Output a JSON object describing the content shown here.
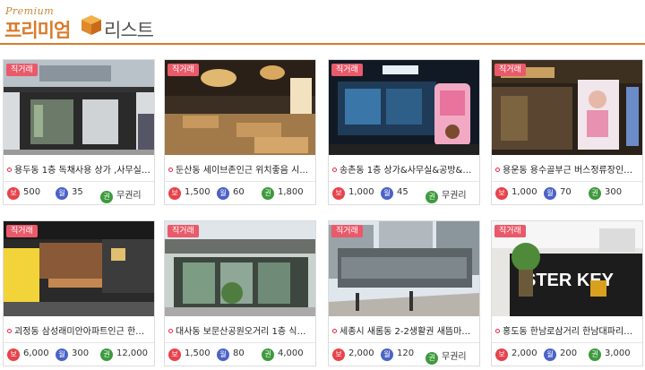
{
  "header": {
    "logo_premium": "Premium",
    "logo_text_1": "프리미엄",
    "logo_text_2": "리스트"
  },
  "labels": {
    "bo": "보",
    "wol": "월",
    "gwon": "권"
  },
  "colors": {
    "accent": "#d97b2a",
    "badge": "#e95a6a",
    "bo": "#e8424b",
    "wol": "#4b63c8",
    "gwon": "#3d9a3d"
  },
  "listings": [
    {
      "badge": "직거래",
      "title": "용두동 1층 독채사용 상가 ,사무실 ...",
      "deposit": "500",
      "monthly": "35",
      "premium": "무권리"
    },
    {
      "badge": "직거래",
      "title": "둔산동 세이브존인근 위치좋음 시...",
      "deposit": "1,500",
      "monthly": "60",
      "premium": "1,800"
    },
    {
      "badge": "직거래",
      "title": "송촌동 1층 상가&사무실&공방&작...",
      "deposit": "1,000",
      "monthly": "45",
      "premium": "무권리"
    },
    {
      "badge": "직거래",
      "title": "용운동 용수골부근 버스정류장인근...",
      "deposit": "1,000",
      "monthly": "70",
      "premium": "300"
    },
    {
      "badge": "직거래",
      "title": "괴정동 삼성래미안아파트인근 한민...",
      "deposit": "6,000",
      "monthly": "300",
      "premium": "12,000"
    },
    {
      "badge": "직거래",
      "title": "대사동 보문산공원오거리 1층 식당...",
      "deposit": "1,500",
      "monthly": "80",
      "premium": "4,000"
    },
    {
      "badge": "직거래",
      "title": "세종시 새롬동 2-2생활권 새뜸마을...",
      "deposit": "2,000",
      "monthly": "120",
      "premium": "무권리"
    },
    {
      "badge": "직거래",
      "title": "홍도동 한남로삼거리 한남대파리바...",
      "deposit": "2,000",
      "monthly": "200",
      "premium": "3,000"
    }
  ],
  "photo_signage": {
    "p7_sign": "STER KEY"
  }
}
